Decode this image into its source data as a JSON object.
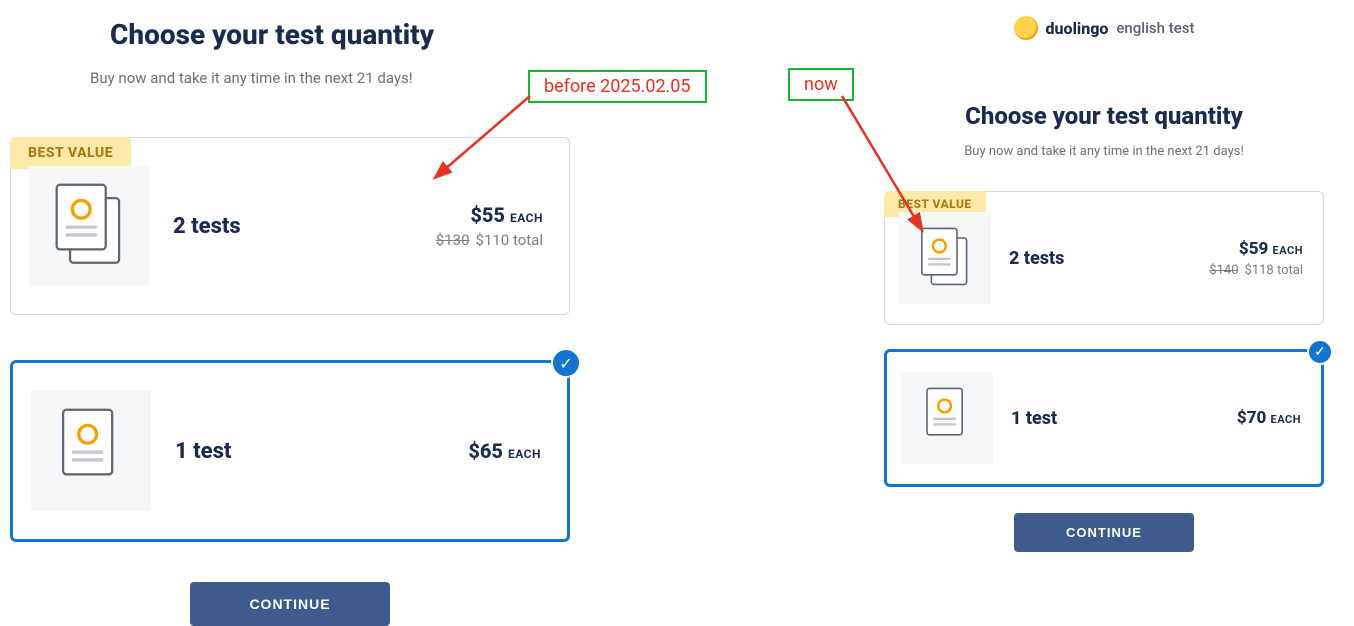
{
  "left": {
    "heading": "Choose your test quantity",
    "subtitle": "Buy now and take it any time in the next 21 days!",
    "best_value_label": "BEST VALUE",
    "card_two": {
      "title": "2 tests",
      "price_each": "$55",
      "each_label": "EACH",
      "strike_total": "$130",
      "total": "$110 total"
    },
    "card_one": {
      "title": "1 test",
      "price_each": "$65",
      "each_label": "EACH"
    },
    "continue_label": "CONTINUE"
  },
  "right": {
    "brand_name": "duolingo",
    "brand_sub": "english test",
    "heading": "Choose your test quantity",
    "subtitle": "Buy now and take it any time in the next 21 days!",
    "best_value_label": "BEST VALUE",
    "card_two": {
      "title": "2 tests",
      "price_each": "$59",
      "each_label": "EACH",
      "strike_total": "$140",
      "total": "$118 total"
    },
    "card_one": {
      "title": "1 test",
      "price_each": "$70",
      "each_label": "EACH"
    },
    "continue_label": "CONTINUE"
  },
  "annotations": {
    "before_label": "before 2025.02.05",
    "now_label": "now"
  }
}
